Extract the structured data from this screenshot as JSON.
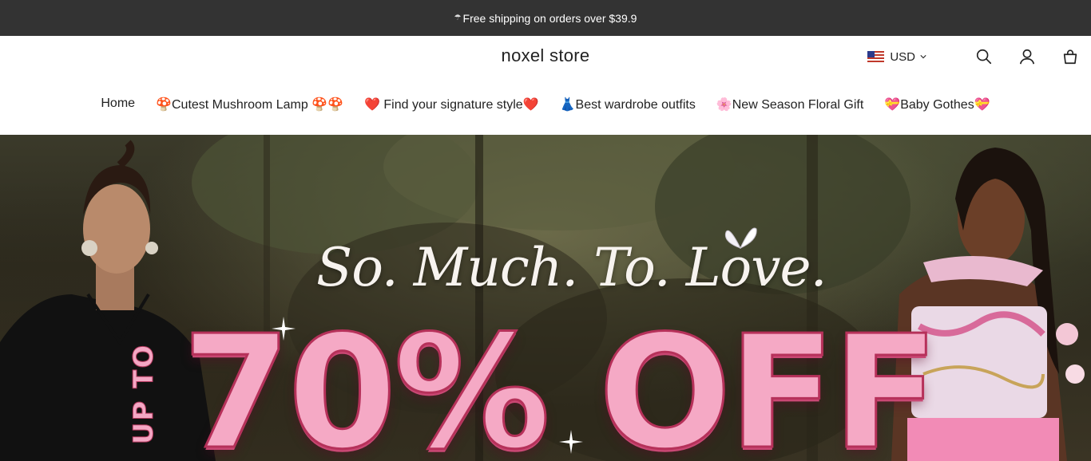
{
  "announcement": {
    "icon": "umbrella-icon",
    "text": "Free shipping on orders over $39.9"
  },
  "header": {
    "logo": "noxel store",
    "currency": {
      "flag": "us-flag-icon",
      "label": "USD"
    },
    "icons": [
      "search-icon",
      "account-icon",
      "cart-icon"
    ]
  },
  "nav": {
    "items": [
      {
        "label": "Home"
      },
      {
        "label": "🍄Cutest Mushroom Lamp 🍄🍄"
      },
      {
        "label": "❤️ Find your signature style❤️"
      },
      {
        "label": "👗Best wardrobe outfits"
      },
      {
        "label": "🌸New Season Floral Gift"
      },
      {
        "label": "💝Baby Gothes💝"
      }
    ]
  },
  "hero": {
    "tagline": "So. Much. To. Love.",
    "prefix": "UP TO",
    "offer": "70% OFF",
    "colors": {
      "pink": "#f5a9c5",
      "outline": "#b6315a",
      "dark_bg": "#2c2a1e"
    }
  }
}
